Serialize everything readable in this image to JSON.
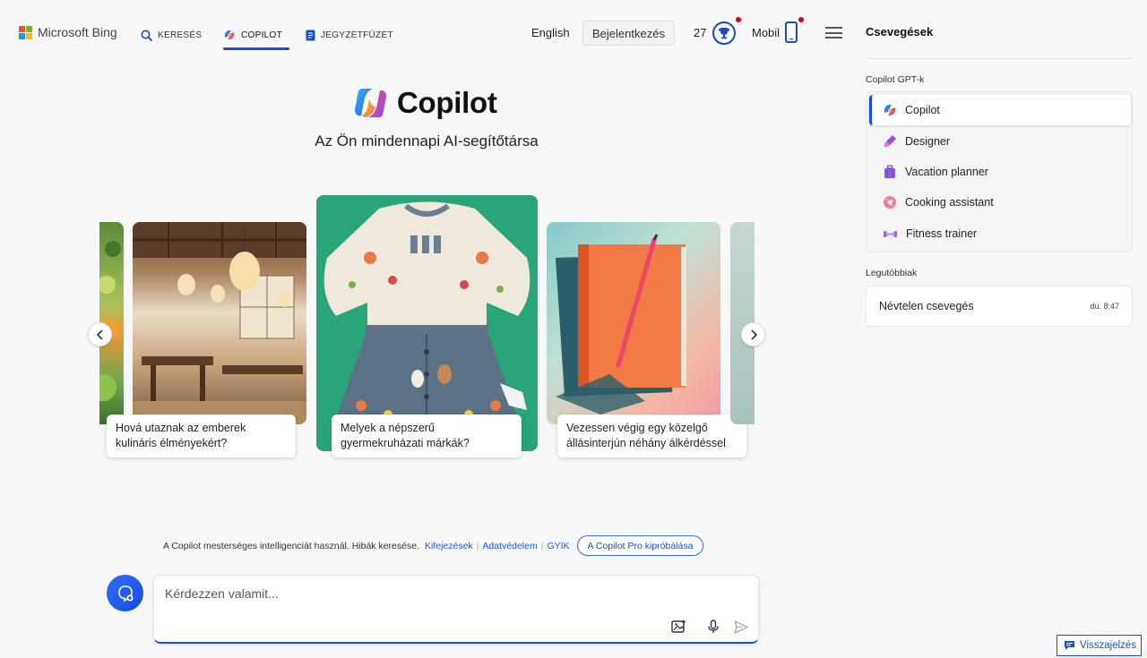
{
  "header": {
    "brand": "Microsoft Bing",
    "tabs": [
      {
        "label": "KERESÉS"
      },
      {
        "label": "COPILOT"
      },
      {
        "label": "JEGYZETFÜZET"
      }
    ],
    "language": "English",
    "login_label": "Bejelentkezés",
    "reward_count": "27",
    "mobile_label": "Mobil"
  },
  "hero": {
    "title": "Copilot",
    "subtitle": "Az Ön mindennapi AI-segítőtársa"
  },
  "carousel": {
    "cards": [
      {
        "caption": "Hová utaznak az emberek kulináris élményekért?"
      },
      {
        "caption": "Melyek a népszerű gyermekruházati márkák?"
      },
      {
        "caption": "Vezessen végig egy közelgő állásinterjún néhány álkérdéssel"
      }
    ]
  },
  "notice": {
    "text": "A Copilot mesterséges intelligenciát használ. Hibák keresése.",
    "links": [
      "Kifejezések",
      "Adatvédelem",
      "GYIK"
    ],
    "pro_button": "A Copilot Pro kipróbálása"
  },
  "input": {
    "placeholder": "Kérdezzen valamit..."
  },
  "sidebar": {
    "title": "Csevegések",
    "gpt_section": "Copilot GPT-k",
    "gpts": [
      {
        "label": "Copilot",
        "icon": "copilot-icon"
      },
      {
        "label": "Designer",
        "icon": "designer-icon"
      },
      {
        "label": "Vacation planner",
        "icon": "suitcase-icon"
      },
      {
        "label": "Cooking assistant",
        "icon": "donut-icon"
      },
      {
        "label": "Fitness trainer",
        "icon": "dumbbell-icon"
      }
    ],
    "recent_section": "Legutóbbiak",
    "recent": [
      {
        "title": "Névtelen csevegés",
        "time": "du. 8:47"
      }
    ],
    "feedback": "Visszajelzés"
  },
  "colors": {
    "accent": "#174ae4",
    "link": "#1a5fd0",
    "background": "#f7f7f7"
  }
}
